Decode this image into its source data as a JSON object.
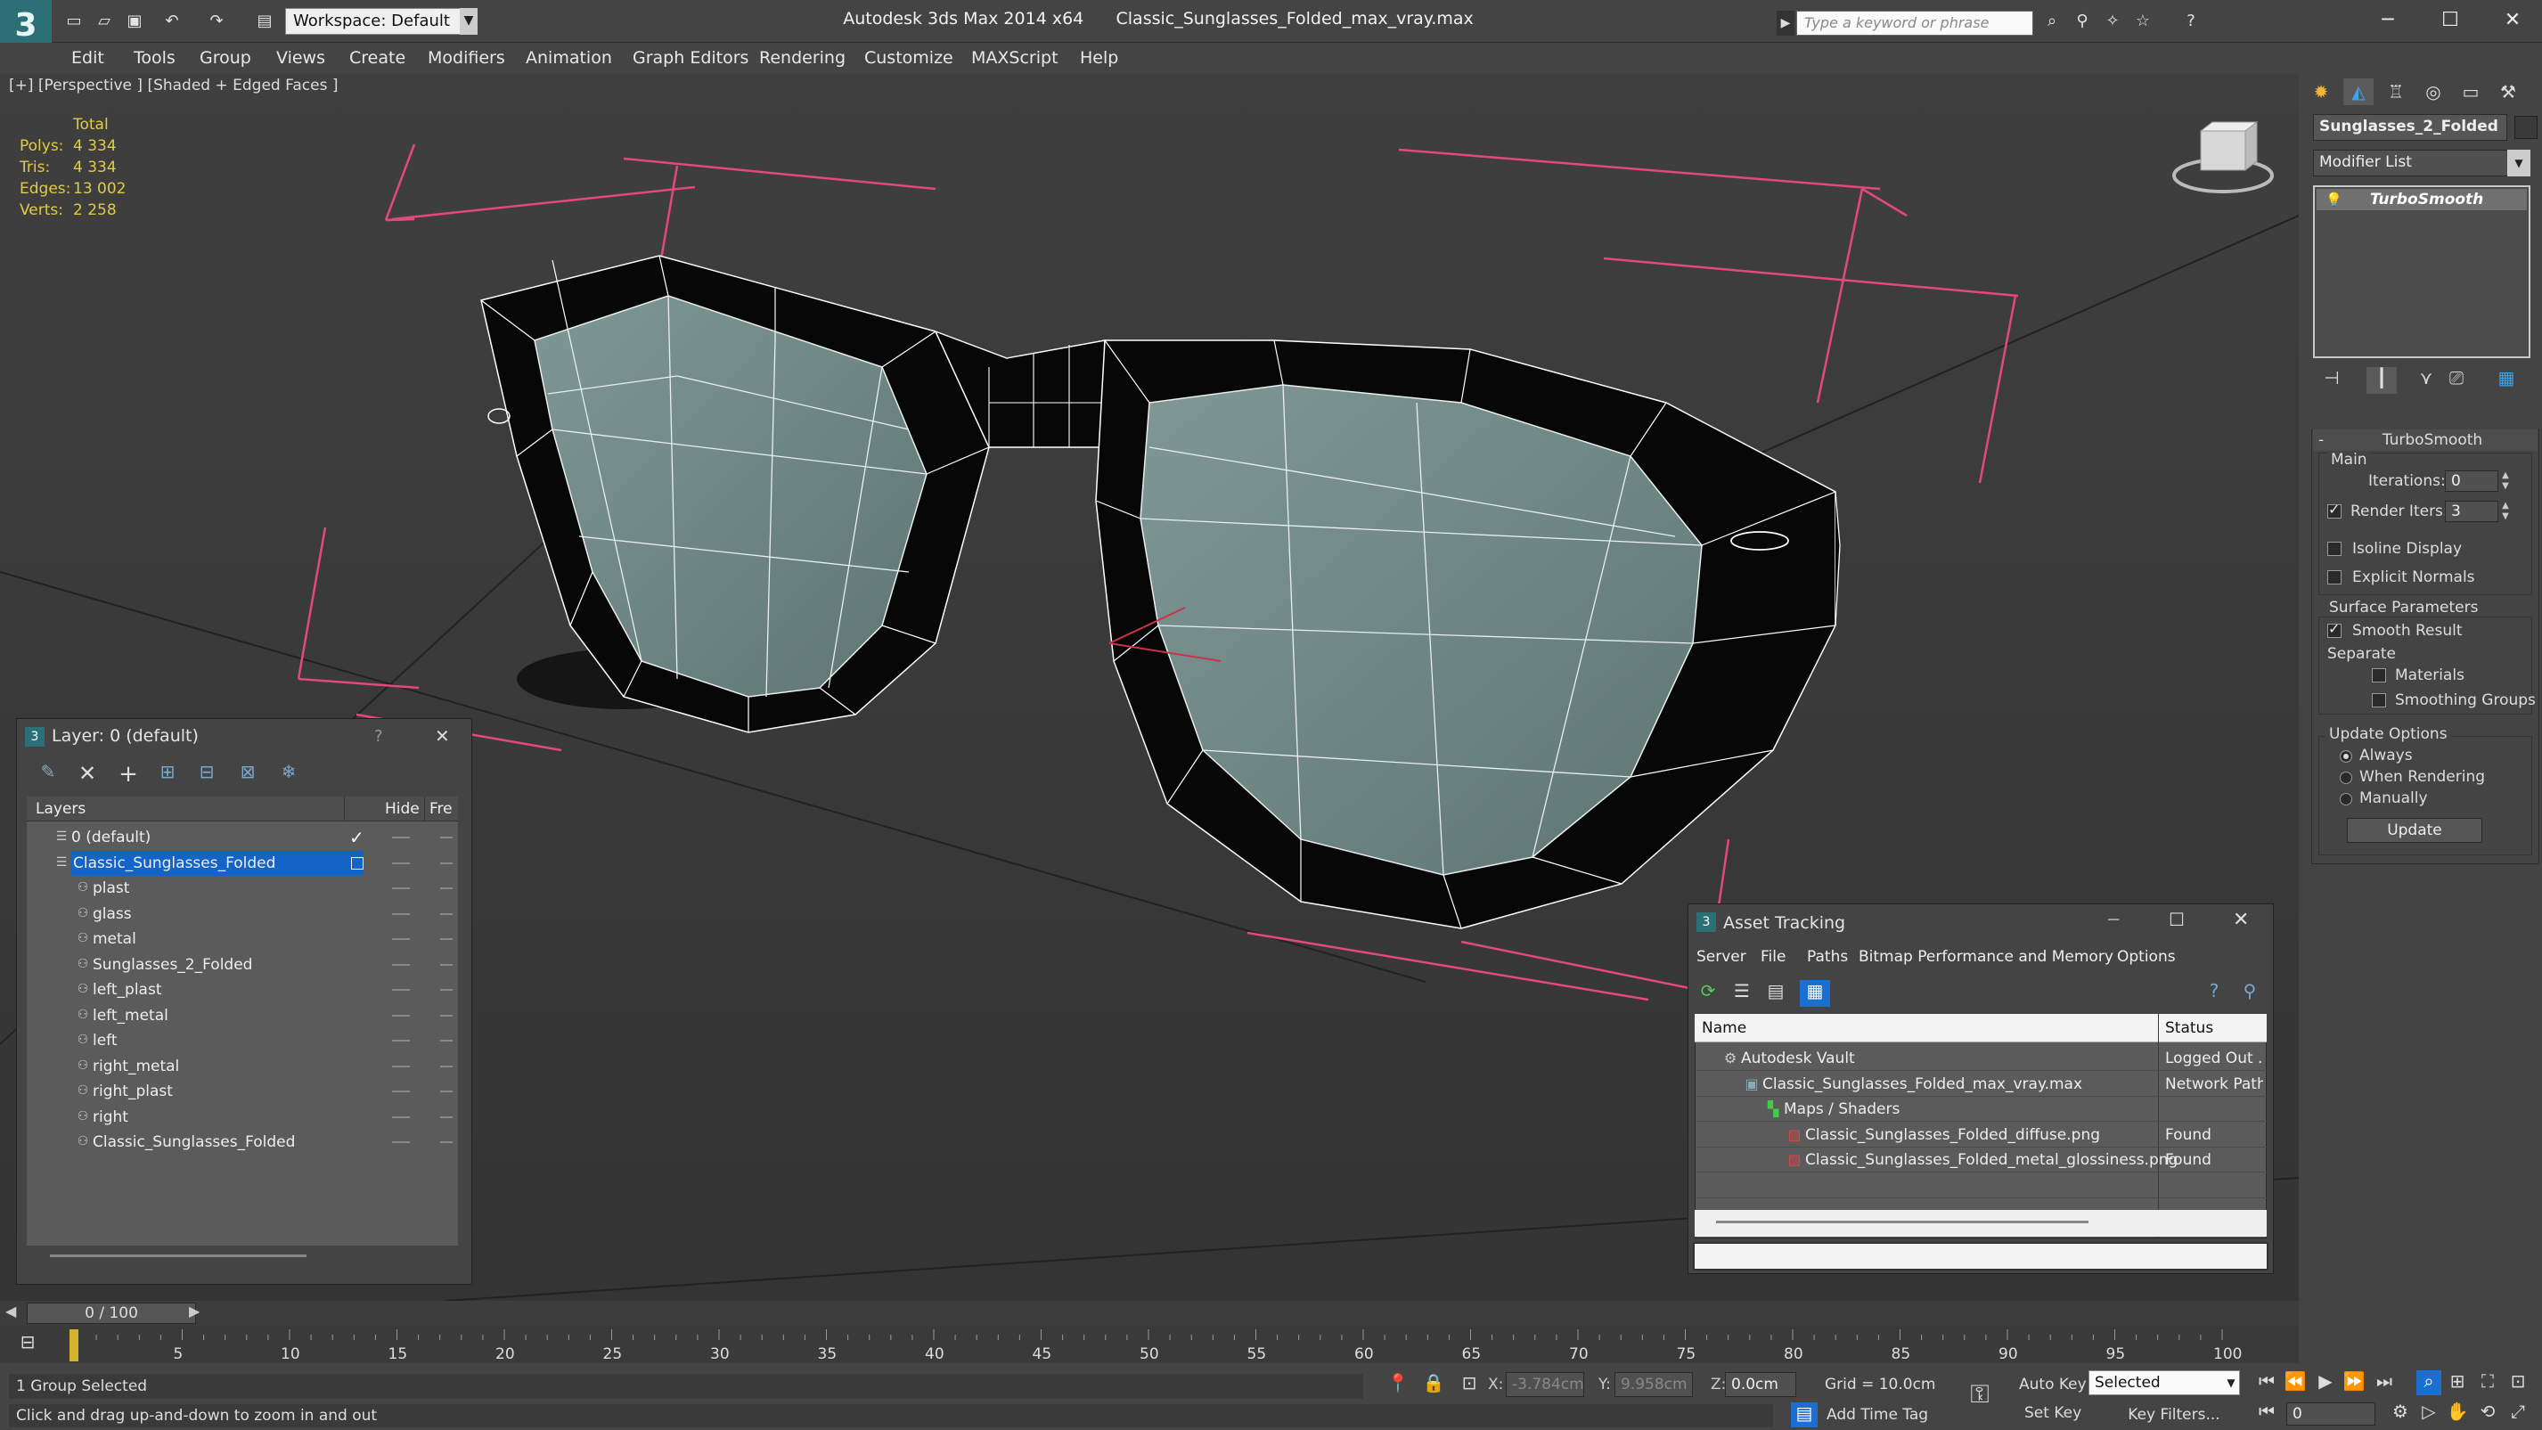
{
  "app": {
    "title": "Autodesk 3ds Max  2014 x64",
    "filename": "Classic_Sunglasses_Folded_max_vray.max",
    "workspace": "Workspace: Default",
    "search_placeholder": "Type a keyword or phrase",
    "logo_glyph": "3"
  },
  "menu": [
    "Edit",
    "Tools",
    "Group",
    "Views",
    "Create",
    "Modifiers",
    "Animation",
    "Graph Editors",
    "Rendering",
    "Customize",
    "MAXScript",
    "Help"
  ],
  "viewport": {
    "label": "[+] [Perspective ] [Shaded + Edged Faces ]",
    "stats": {
      "header": "Total",
      "rows": [
        {
          "label": "Polys:",
          "value": "4 334"
        },
        {
          "label": "Tris:",
          "value": "4 334"
        },
        {
          "label": "Edges:",
          "value": "13 002"
        },
        {
          "label": "Verts:",
          "value": "2 258"
        }
      ]
    }
  },
  "command_panel": {
    "object_name": "Sunglasses_2_Folded",
    "modifier_list": "Modifier List",
    "stack_item": "TurboSmooth",
    "rollout_title": "TurboSmooth",
    "main_label": "Main",
    "iterations_label": "Iterations:",
    "iterations_value": "0",
    "render_iters_label": "Render Iters:",
    "render_iters_value": "3",
    "isoline": "Isoline Display",
    "explicit_normals": "Explicit Normals",
    "surface_params": "Surface Parameters",
    "smooth_result": "Smooth Result",
    "separate": "Separate",
    "materials": "Materials",
    "smoothing_groups": "Smoothing Groups",
    "update_options": "Update Options",
    "always": "Always",
    "when_rendering": "When Rendering",
    "manually": "Manually",
    "update_button": "Update"
  },
  "layer_dialog": {
    "title": "Layer: 0 (default)",
    "help": "?",
    "close": "✕",
    "col_layers": "Layers",
    "col_hide": "Hide",
    "col_freeze": "Fre",
    "layers": [
      {
        "name": "0 (default)",
        "indent": 1,
        "current": true,
        "selected": false
      },
      {
        "name": "Classic_Sunglasses_Folded",
        "indent": 1,
        "current": false,
        "selected": true
      },
      {
        "name": "plast",
        "indent": 2,
        "current": false,
        "selected": false
      },
      {
        "name": "glass",
        "indent": 2,
        "current": false,
        "selected": false
      },
      {
        "name": "metal",
        "indent": 2,
        "current": false,
        "selected": false
      },
      {
        "name": "Sunglasses_2_Folded",
        "indent": 2,
        "current": false,
        "selected": false
      },
      {
        "name": "left_plast",
        "indent": 2,
        "current": false,
        "selected": false
      },
      {
        "name": "left_metal",
        "indent": 2,
        "current": false,
        "selected": false
      },
      {
        "name": "left",
        "indent": 2,
        "current": false,
        "selected": false
      },
      {
        "name": "right_metal",
        "indent": 2,
        "current": false,
        "selected": false
      },
      {
        "name": "right_plast",
        "indent": 2,
        "current": false,
        "selected": false
      },
      {
        "name": "right",
        "indent": 2,
        "current": false,
        "selected": false
      },
      {
        "name": "Classic_Sunglasses_Folded",
        "indent": 2,
        "current": false,
        "selected": false
      }
    ]
  },
  "asset_dialog": {
    "title": "Asset Tracking",
    "menu": [
      "Server",
      "File",
      "Paths",
      "Bitmap Performance and Memory",
      "Options"
    ],
    "col_name": "Name",
    "col_status": "Status",
    "rows": [
      {
        "name": "Autodesk Vault",
        "status": "Logged Out ...",
        "indent": 1,
        "icon": "vault-icon"
      },
      {
        "name": "Classic_Sunglasses_Folded_max_vray.max",
        "status": "Network Path",
        "indent": 2,
        "icon": "max-file-icon"
      },
      {
        "name": "Maps / Shaders",
        "status": "",
        "indent": 3,
        "icon": "maps-icon"
      },
      {
        "name": "Classic_Sunglasses_Folded_diffuse.png",
        "status": "Found",
        "indent": 4,
        "icon": "png-icon"
      },
      {
        "name": "Classic_Sunglasses_Folded_metal_glossiness.png",
        "status": "Found",
        "indent": 4,
        "icon": "png-icon"
      }
    ]
  },
  "timeline": {
    "frame_display": "0 / 100",
    "ticks": [
      "5",
      "10",
      "15",
      "20",
      "25",
      "30",
      "35",
      "40",
      "45",
      "50",
      "55",
      "60",
      "65",
      "70",
      "75",
      "80",
      "85",
      "90",
      "95",
      "100"
    ]
  },
  "status": {
    "selection": "1 Group Selected",
    "prompt": "Click and drag up-and-down to zoom in and out",
    "x_label": "X:",
    "x_value": "-3.784cm",
    "y_label": "Y:",
    "y_value": "9.958cm",
    "z_label": "Z:",
    "z_value": "0.0cm",
    "grid": "Grid = 10.0cm",
    "auto_key": "Auto Key",
    "set_key": "Set Key",
    "selected": "Selected",
    "key_filters": "Key Filters...",
    "add_time_tag": "Add Time Tag",
    "frame": "0"
  },
  "colors": {
    "accent": "#1a6fd1",
    "selection": "#1463c7",
    "stat_yellow": "#e0cc44",
    "viewport_bg": "#3a3a3a",
    "lens": "#6f8a88",
    "frame": "#070707",
    "pink": "#e3487f"
  }
}
